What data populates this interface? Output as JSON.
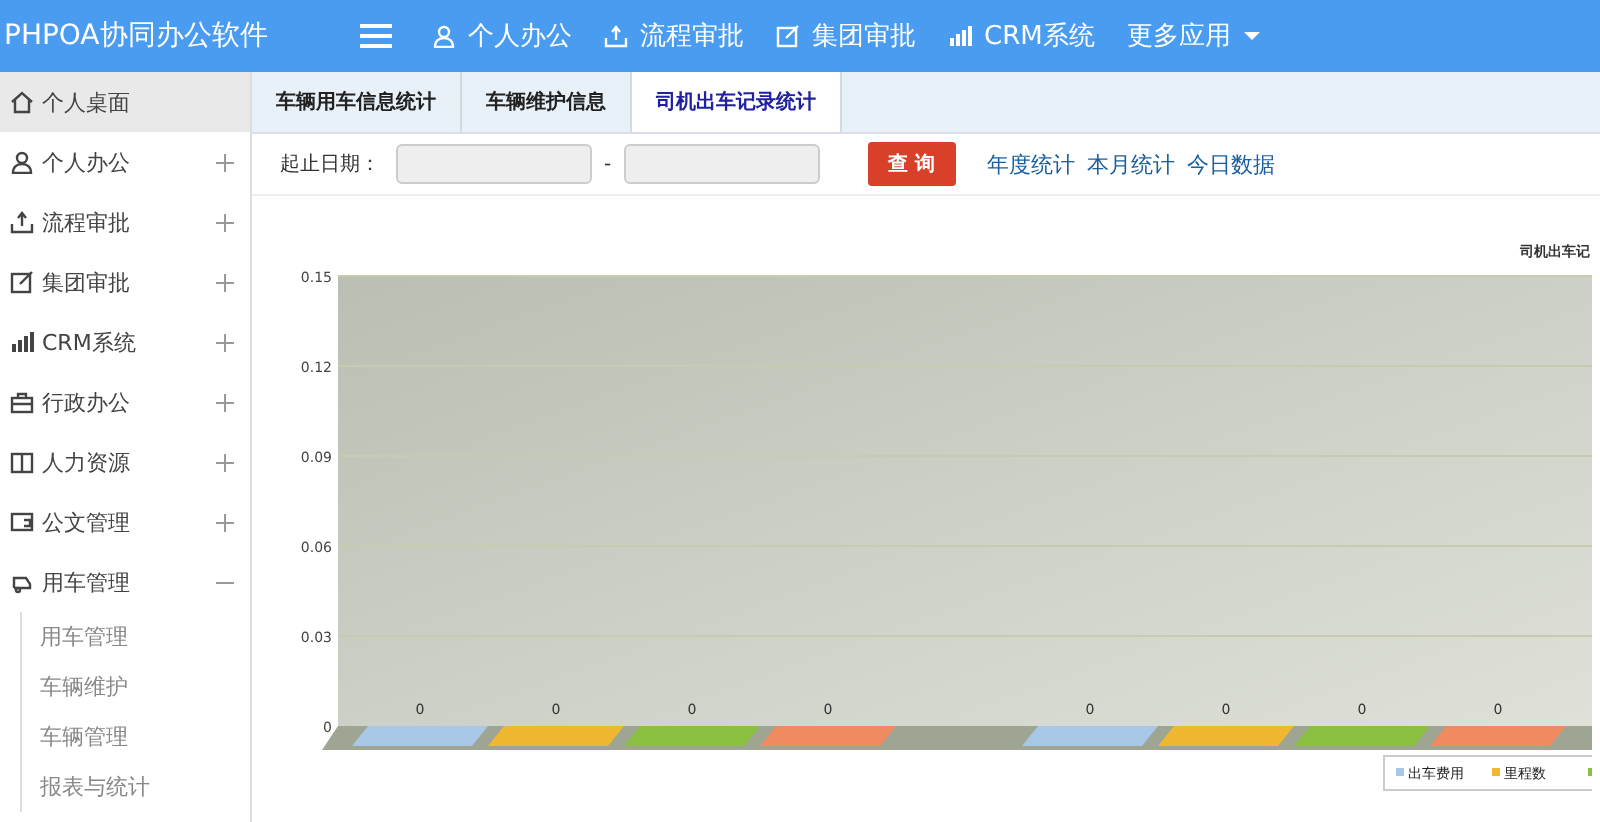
{
  "header": {
    "brand": "PHPOA协同办公软件",
    "nav": [
      {
        "label": "个人办公",
        "kind": "link"
      },
      {
        "label": "流程审批",
        "kind": "link"
      },
      {
        "label": "集团审批",
        "kind": "link"
      },
      {
        "label": "CRM系统",
        "kind": "link"
      },
      {
        "label": "更多应用",
        "kind": "dropdown"
      }
    ]
  },
  "sidebar": {
    "items": [
      {
        "label": "个人桌面",
        "selected": true,
        "expanded": false
      },
      {
        "label": "个人办公",
        "selected": false,
        "expanded": false
      },
      {
        "label": "流程审批",
        "selected": false,
        "expanded": false
      },
      {
        "label": "集团审批",
        "selected": false,
        "expanded": false
      },
      {
        "label": "CRM系统",
        "selected": false,
        "expanded": false
      },
      {
        "label": "行政办公",
        "selected": false,
        "expanded": false
      },
      {
        "label": "人力资源",
        "selected": false,
        "expanded": false
      },
      {
        "label": "公文管理",
        "selected": false,
        "expanded": false
      },
      {
        "label": "用车管理",
        "selected": false,
        "expanded": true,
        "children": [
          {
            "label": "用车管理"
          },
          {
            "label": "车辆维护"
          },
          {
            "label": "车辆管理"
          },
          {
            "label": "报表与统计"
          }
        ]
      }
    ]
  },
  "tabs": [
    {
      "label": "车辆用车信息统计",
      "selected": false
    },
    {
      "label": "车辆维护信息",
      "selected": false
    },
    {
      "label": "司机出车记录统计",
      "selected": true
    }
  ],
  "filter": {
    "label": "起止日期：",
    "separator": "-",
    "search_button": "查 询",
    "links": [
      "年度统计",
      "本月统计",
      "今日数据"
    ]
  },
  "chart_data": {
    "type": "bar",
    "title": "司机出车记",
    "yticks": [
      0,
      0.03,
      0.06,
      0.09,
      0.12,
      0.15
    ],
    "ylim": [
      0,
      0.15
    ],
    "data_labels": true,
    "grid": true,
    "legend": "bottom-right",
    "series": [
      {
        "name": "出车费用",
        "color": "#a9c8e8",
        "values": [
          0,
          0
        ]
      },
      {
        "name": "里程数",
        "color": "#f0b830",
        "values": [
          0,
          0
        ]
      },
      {
        "color": "#8cc040",
        "values": [
          0,
          0
        ]
      },
      {
        "color": "#f08a60",
        "values": [
          0,
          0
        ]
      }
    ]
  }
}
